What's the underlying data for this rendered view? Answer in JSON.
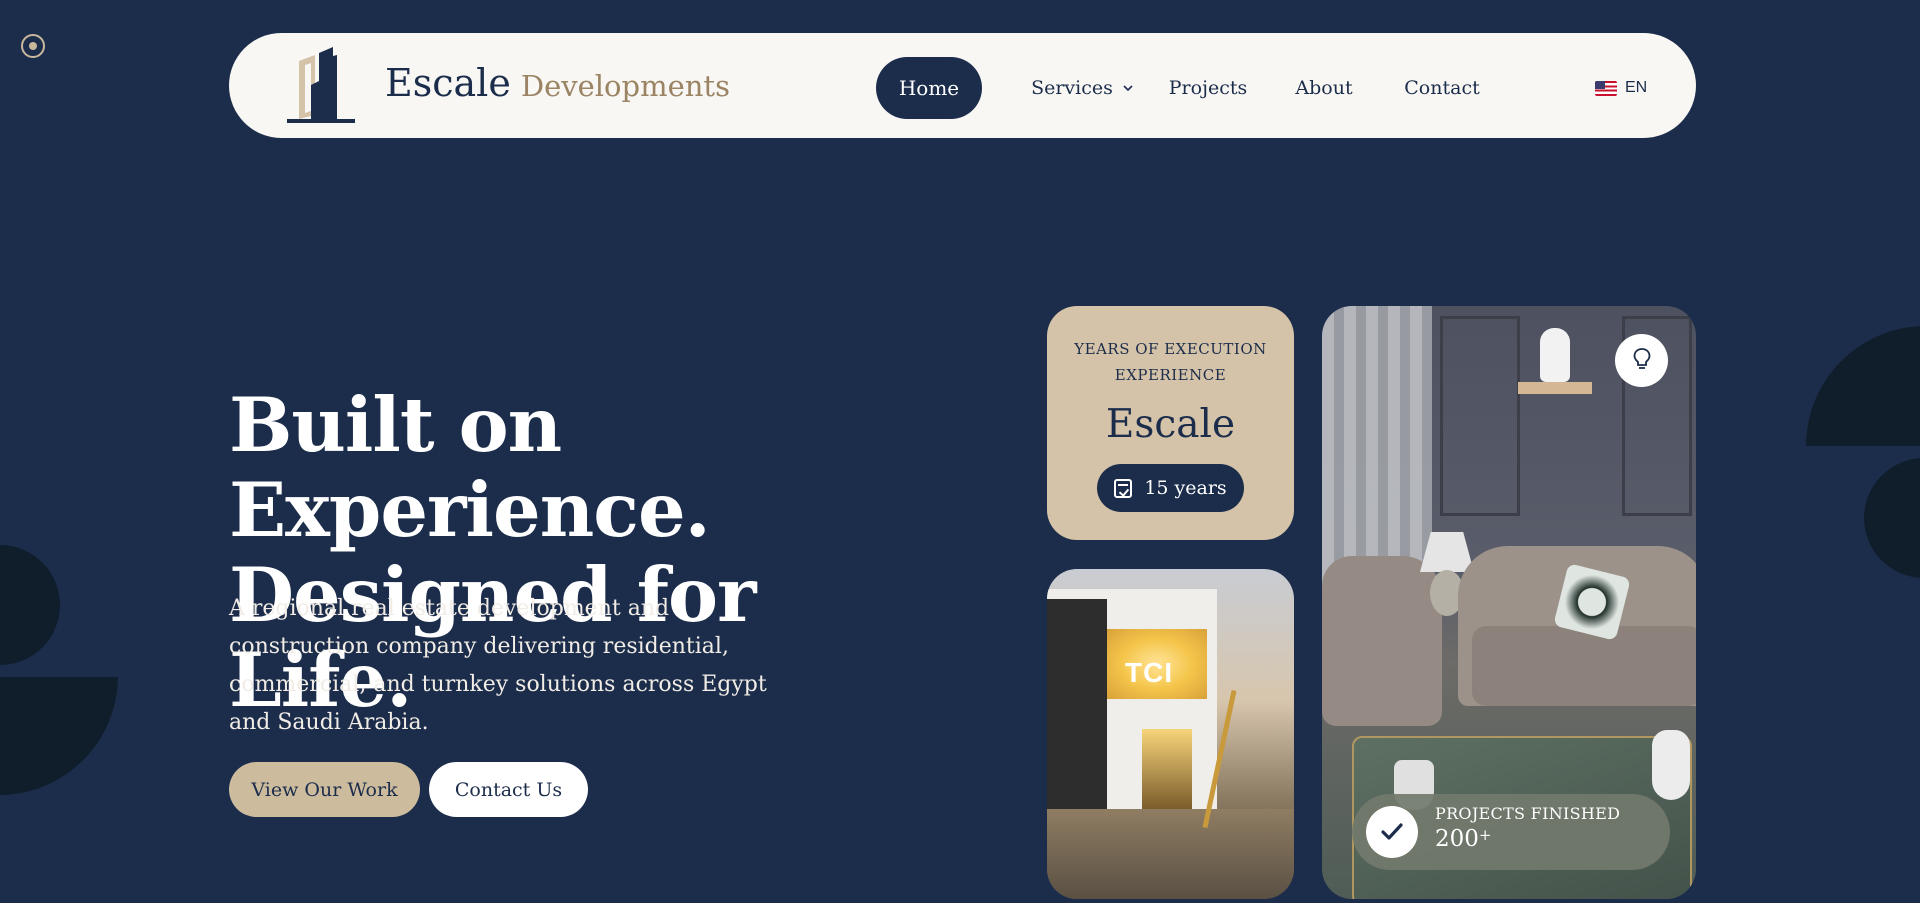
{
  "nav": {
    "brand_main": "Escale",
    "brand_sub": "Developments",
    "links": [
      {
        "label": "Home",
        "active": true
      },
      {
        "label": "Services",
        "has_dropdown": true
      },
      {
        "label": "Projects"
      },
      {
        "label": "About"
      },
      {
        "label": "Contact"
      }
    ],
    "language": "EN",
    "language_icon": "us-flag-icon"
  },
  "hero": {
    "title_line1": "Built on Experience.",
    "title_line2": "Designed for Life.",
    "description": "A regional real estate development and construction company delivering residential, commercial, and turnkey solutions across Egypt and Saudi Arabia.",
    "primary_button": "View Our Work",
    "secondary_button": "Contact Us"
  },
  "experience_card": {
    "label": "YEARS OF EXECUTION EXPERIENCE",
    "brand": "Escale",
    "years": "15 years",
    "icon": "calendar-check-icon"
  },
  "photo_card": {
    "sign_text": "TCI"
  },
  "stats": {
    "label": "PROJECTS  FINISHED",
    "value": "200",
    "suffix": "+",
    "icon": "check-icon"
  },
  "colors": {
    "background": "#1c2d4b",
    "navbar": "#f8f7f4",
    "accent_beige": "#cdbb9e",
    "brand_gold": "#9b8464",
    "dark_shape": "#101e2c"
  }
}
